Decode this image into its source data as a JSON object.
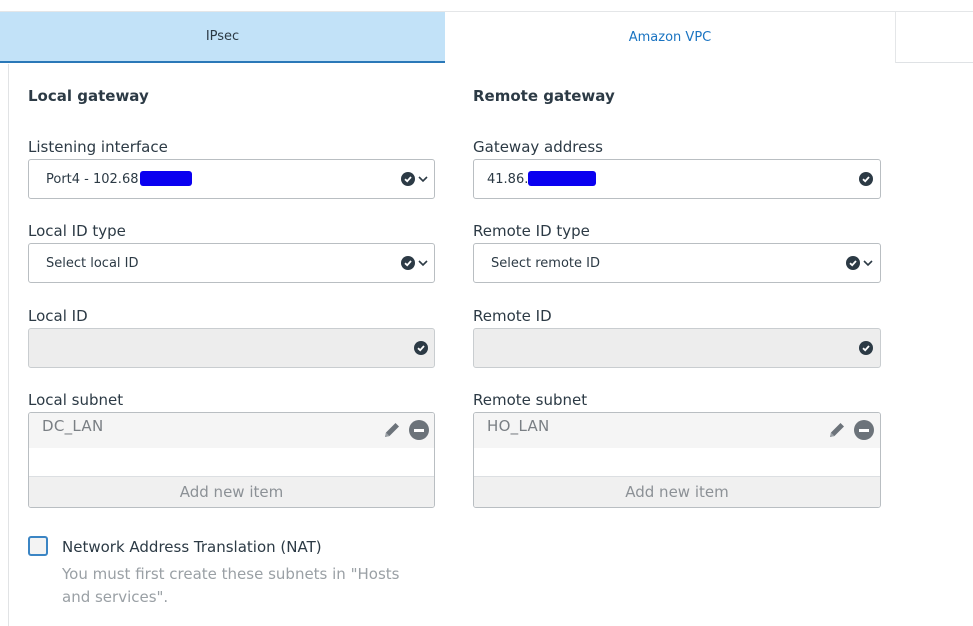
{
  "tabs": [
    {
      "label": "IPsec"
    },
    {
      "label": "Amazon VPC"
    }
  ],
  "local": {
    "title": "Local gateway",
    "listening_interface_label": "Listening interface",
    "listening_interface_value": "Port4 - 102.68",
    "local_id_type_label": "Local ID type",
    "local_id_type_value": "Select local ID",
    "local_id_label": "Local ID",
    "local_subnet_label": "Local subnet",
    "local_subnet_items": [
      "DC_LAN"
    ],
    "add_new_item": "Add new item"
  },
  "remote": {
    "title": "Remote gateway",
    "gateway_address_label": "Gateway address",
    "gateway_address_value": "41.86.",
    "remote_id_type_label": "Remote ID type",
    "remote_id_type_value": "Select remote ID",
    "remote_id_label": "Remote ID",
    "remote_subnet_label": "Remote subnet",
    "remote_subnet_items": [
      "HO_LAN"
    ],
    "add_new_item": "Add new item"
  },
  "nat": {
    "label": "Network Address Translation (NAT)",
    "checked": false,
    "help": "You must first create these subnets in \"Hosts and services\"."
  },
  "colors": {
    "active_tab_bg": "#c2e2f8",
    "link_blue": "#1a74c2",
    "redaction": "#0a00f0"
  },
  "icons": [
    "check-circle-icon",
    "chevron-down-icon",
    "pencil-icon",
    "minus-circle-icon"
  ]
}
